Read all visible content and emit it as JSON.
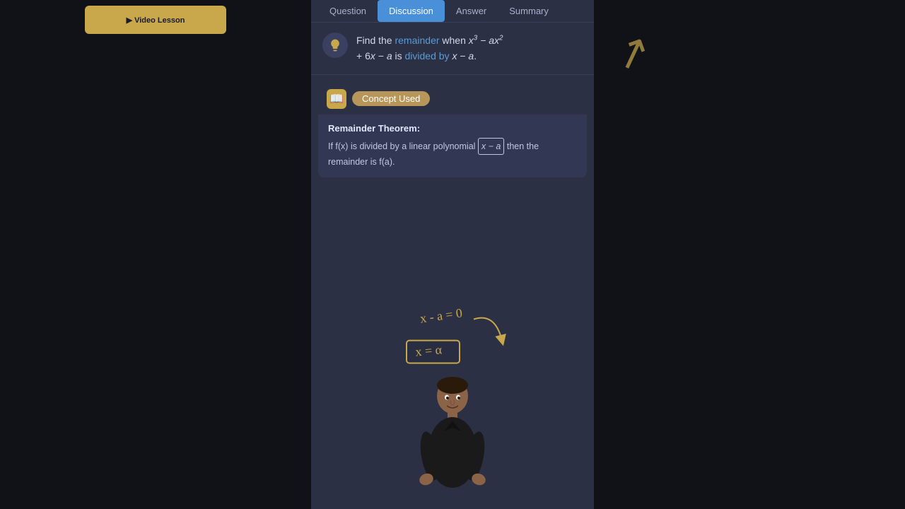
{
  "tabs": {
    "items": [
      {
        "label": "Question",
        "active": false
      },
      {
        "label": "Discussion",
        "active": true
      },
      {
        "label": "Answer",
        "active": false
      },
      {
        "label": "Summary",
        "active": false
      }
    ]
  },
  "question": {
    "text_pre": "Find the ",
    "highlight1": "remainder",
    "text_mid1": " when ",
    "math_expr": "x³ − ax²",
    "text_mid2": " + 6x − a is ",
    "highlight2": "divided by",
    "text_post": " x − a."
  },
  "concept": {
    "section_title": "Concept Used",
    "theorem_title": "Remainder Theorem:",
    "theorem_text_pre": "If f(x) is divided by a linear polynomial",
    "theorem_boxed": "x − a",
    "theorem_text_post": " then the remainder is f(a)."
  },
  "annotation": {
    "line1": "x - a = 0",
    "line2": "x = a"
  },
  "colors": {
    "active_tab": "#4a90d9",
    "highlight_blue": "#5b9bd5",
    "accent_gold": "#c8a84b",
    "bg_dark": "#2b3044",
    "bg_darker": "#1e2235"
  }
}
